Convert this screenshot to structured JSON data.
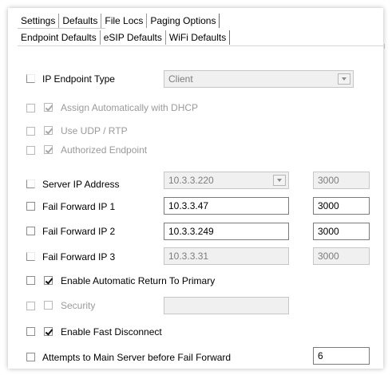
{
  "tabs_row1": [
    "Settings",
    "Defaults",
    "File Locs",
    "Paging Options"
  ],
  "tabs_row2": [
    "Endpoint Defaults",
    "eSIP Defaults",
    "WiFi Defaults"
  ],
  "fields": {
    "ip_endpoint_type": {
      "label": "IP Endpoint Type",
      "value": "Client",
      "override": false
    },
    "assign_dhcp": {
      "label": "Assign Automatically with DHCP",
      "checked": true,
      "enabled": false
    },
    "use_udp_rtp": {
      "label": "Use UDP / RTP",
      "checked": true,
      "enabled": false
    },
    "authorized_endpoint": {
      "label": "Authorized Endpoint",
      "checked": true,
      "enabled": false
    },
    "server_ip": {
      "label": "Server IP Address",
      "value": "10.3.3.220",
      "port": "3000",
      "enabled": false
    },
    "fail_forward_1": {
      "label": "Fail Forward IP 1",
      "value": "10.3.3.47",
      "port": "3000",
      "enabled": true
    },
    "fail_forward_2": {
      "label": "Fail Forward IP 2",
      "value": "10.3.3.249",
      "port": "3000",
      "enabled": true
    },
    "fail_forward_3": {
      "label": "Fail Forward IP 3",
      "value": "10.3.3.31",
      "port": "3000",
      "enabled": false
    },
    "auto_return": {
      "label": "Enable Automatic Return To Primary",
      "checked": true
    },
    "security": {
      "label": "Security",
      "value": "",
      "checked": false,
      "enabled": false
    },
    "fast_disconnect": {
      "label": "Enable Fast Disconnect",
      "checked": true
    },
    "attempts": {
      "label": "Attempts to Main Server before Fail Forward",
      "value": "6"
    }
  }
}
